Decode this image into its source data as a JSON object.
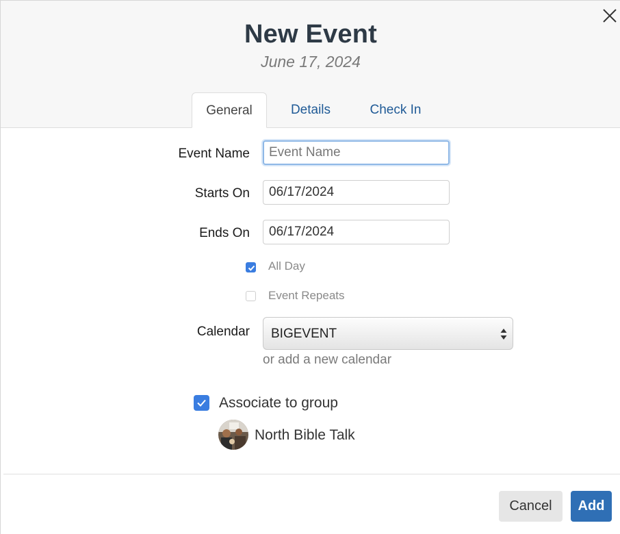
{
  "header": {
    "title": "New Event",
    "date": "June 17, 2024"
  },
  "tabs": [
    {
      "label": "General",
      "active": true
    },
    {
      "label": "Details",
      "active": false
    },
    {
      "label": "Check In",
      "active": false
    }
  ],
  "form": {
    "event_name": {
      "label": "Event Name",
      "value": "",
      "placeholder": "Event Name"
    },
    "starts_on": {
      "label": "Starts On",
      "value": "06/17/2024"
    },
    "ends_on": {
      "label": "Ends On",
      "value": "06/17/2024"
    },
    "all_day": {
      "label": "All Day",
      "checked": true
    },
    "event_repeats": {
      "label": "Event Repeats",
      "checked": false
    },
    "calendar": {
      "label": "Calendar",
      "selected": "BIGEVENT",
      "add_link": "or add a new calendar"
    },
    "associate": {
      "label": "Associate to group",
      "checked": true
    },
    "group": {
      "name": "North Bible Talk"
    }
  },
  "buttons": {
    "cancel": "Cancel",
    "add": "Add"
  },
  "colors": {
    "accent": "#3a7de0",
    "primary_button": "#2f6fb5",
    "title": "#2e3a46",
    "tab_link": "#1f5a96"
  },
  "icons": {
    "close": "close-icon",
    "select_arrows": "updown-arrows-icon",
    "checkmark": "check-icon"
  }
}
